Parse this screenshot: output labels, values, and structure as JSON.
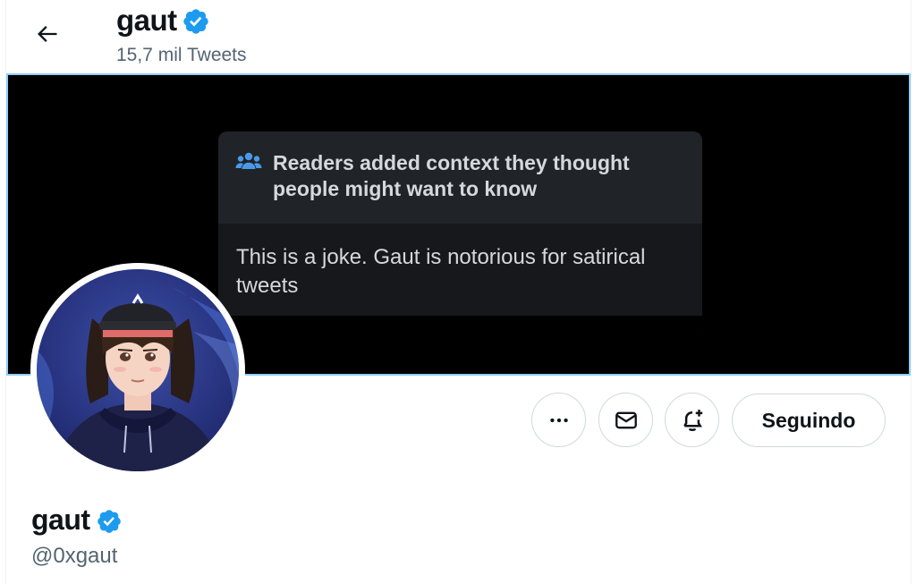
{
  "header": {
    "name": "gaut",
    "tweet_count": "15,7 mil Tweets"
  },
  "banner": {
    "note": {
      "title": "Readers added context they thought people might want to know",
      "body": "This is a joke. Gaut is notorious for satirical tweets"
    }
  },
  "actions": {
    "follow_label": "Seguindo"
  },
  "profile": {
    "name": "gaut",
    "handle": "@0xgaut"
  },
  "icons": {
    "back": "arrow-left-icon",
    "verified": "verified-badge-icon",
    "readers": "people-icon",
    "more": "more-horizontal-icon",
    "message": "envelope-icon",
    "notify": "bell-plus-icon"
  },
  "colors": {
    "verified_blue": "#1d9bf0",
    "text_primary": "#0f1419",
    "text_secondary": "#536471",
    "border": "#cfd9de",
    "note_bg": "#16181c",
    "note_header_bg": "#202327",
    "note_text": "#d6d9db"
  }
}
